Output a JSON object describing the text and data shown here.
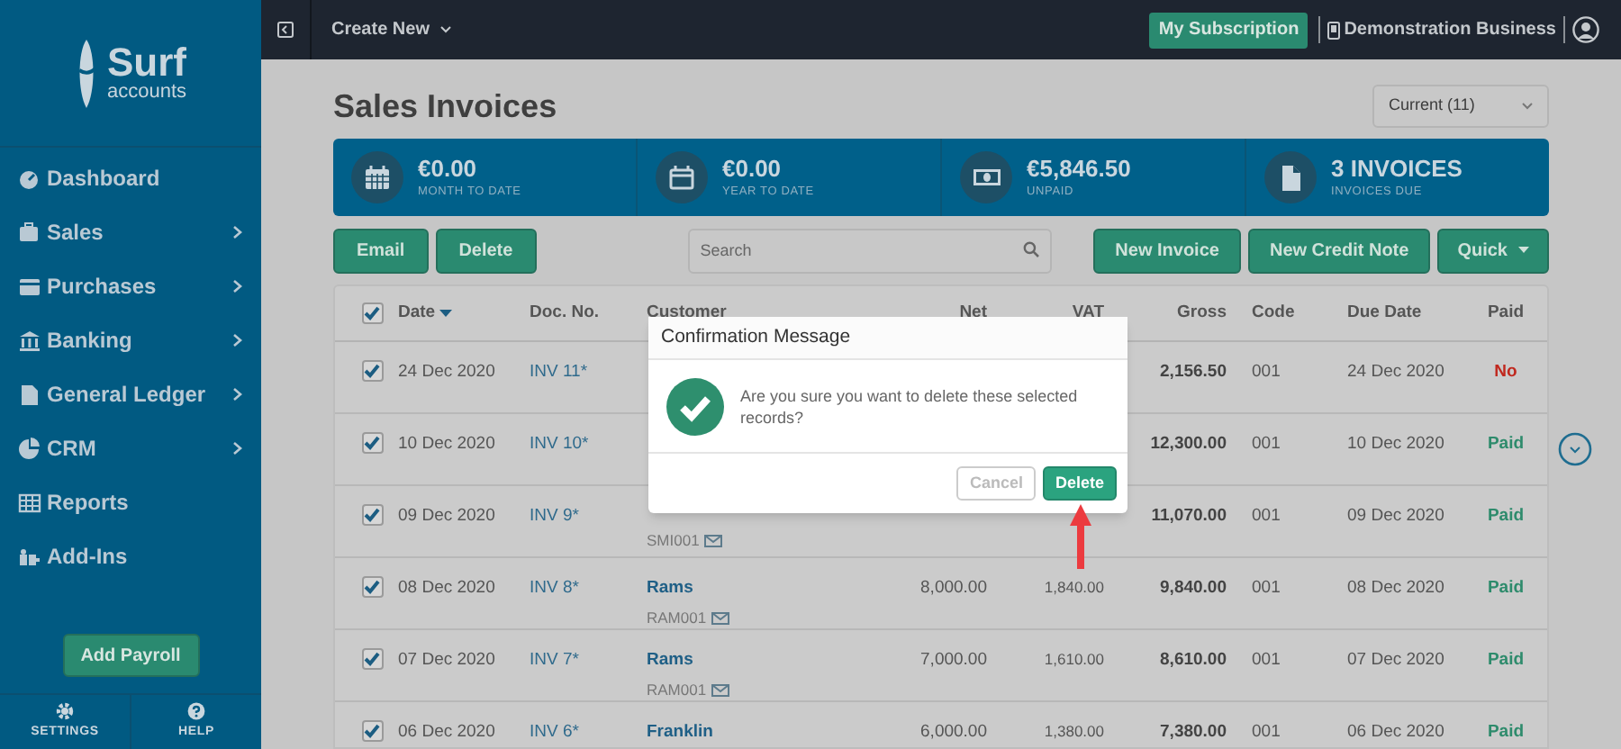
{
  "sidebar": {
    "logo": {
      "name": "Surf",
      "sub": "accounts"
    },
    "items": [
      {
        "label": "Dashboard",
        "has_submenu": false
      },
      {
        "label": "Sales",
        "has_submenu": true
      },
      {
        "label": "Purchases",
        "has_submenu": true
      },
      {
        "label": "Banking",
        "has_submenu": true
      },
      {
        "label": "General Ledger",
        "has_submenu": true
      },
      {
        "label": "CRM",
        "has_submenu": true
      },
      {
        "label": "Reports",
        "has_submenu": false
      },
      {
        "label": "Add-Ins",
        "has_submenu": false
      }
    ],
    "add_payroll": "Add Payroll",
    "footer": [
      {
        "label": "SETTINGS"
      },
      {
        "label": "HELP"
      }
    ]
  },
  "topbar": {
    "create_new": "Create New",
    "subscription": "My Subscription",
    "business": "Demonstration Business"
  },
  "page": {
    "title": "Sales Invoices",
    "period": "Current (11)"
  },
  "stats": [
    {
      "value": "€0.00",
      "label": "MONTH TO DATE"
    },
    {
      "value": "€0.00",
      "label": "YEAR TO DATE"
    },
    {
      "value": "€5,846.50",
      "label": "UNPAID"
    },
    {
      "value": "3 INVOICES",
      "label": "INVOICES DUE"
    }
  ],
  "toolbar": {
    "left": [
      "Email",
      "Delete"
    ],
    "search": {
      "placeholder": "Search"
    },
    "right": [
      "New Invoice",
      "New Credit Note"
    ],
    "quick": "Quick"
  },
  "table": {
    "all_checked": true,
    "columns": [
      {
        "label": "Date",
        "sorted": true
      },
      {
        "label": "Doc. No.",
        "sorted": false
      },
      {
        "label": "Customer",
        "sorted": false
      },
      {
        "label": "Net",
        "sorted": false
      },
      {
        "label": "VAT",
        "sorted": false
      },
      {
        "label": "Gross",
        "sorted": false
      },
      {
        "label": "Code",
        "sorted": false
      },
      {
        "label": "Due Date",
        "sorted": false
      },
      {
        "label": "Paid",
        "sorted": false
      }
    ],
    "rows": [
      {
        "checked": true,
        "date": "24 Dec 2020",
        "doc": "INV 11*",
        "gross": "2,156.50",
        "code": "001",
        "due": "24 Dec 2020",
        "paid": "No",
        "settled": false
      },
      {
        "checked": true,
        "date": "10 Dec 2020",
        "doc": "INV 10*",
        "gross": "12,300.00",
        "code": "001",
        "due": "10 Dec 2020",
        "paid": "Paid",
        "settled": true
      },
      {
        "checked": true,
        "date": "09 Dec 2020",
        "doc": "INV 9*",
        "account": "SMI001",
        "gross": "11,070.00",
        "code": "001",
        "due": "09 Dec 2020",
        "paid": "Paid",
        "settled": true
      },
      {
        "checked": true,
        "date": "08 Dec 2020",
        "doc": "INV 8*",
        "customer": "Rams",
        "account": "RAM001",
        "net": "8,000.00",
        "vat": "1,840.00",
        "gross": "9,840.00",
        "code": "001",
        "due": "08 Dec 2020",
        "paid": "Paid",
        "settled": true
      },
      {
        "checked": true,
        "date": "07 Dec 2020",
        "doc": "INV 7*",
        "customer": "Rams",
        "account": "RAM001",
        "net": "7,000.00",
        "vat": "1,610.00",
        "gross": "8,610.00",
        "code": "001",
        "due": "07 Dec 2020",
        "paid": "Paid",
        "settled": true
      },
      {
        "checked": true,
        "date": "06 Dec 2020",
        "doc": "INV 6*",
        "customer": "Franklin",
        "net": "6,000.00",
        "vat": "1,380.00",
        "gross": "7,380.00",
        "code": "001",
        "due": "06 Dec 2020",
        "paid": "Paid",
        "settled": true
      }
    ]
  },
  "dialog": {
    "title": "Confirmation Message",
    "message": "Are you sure you want to delete these selected records?",
    "cancel": "Cancel",
    "confirm": "Delete"
  }
}
